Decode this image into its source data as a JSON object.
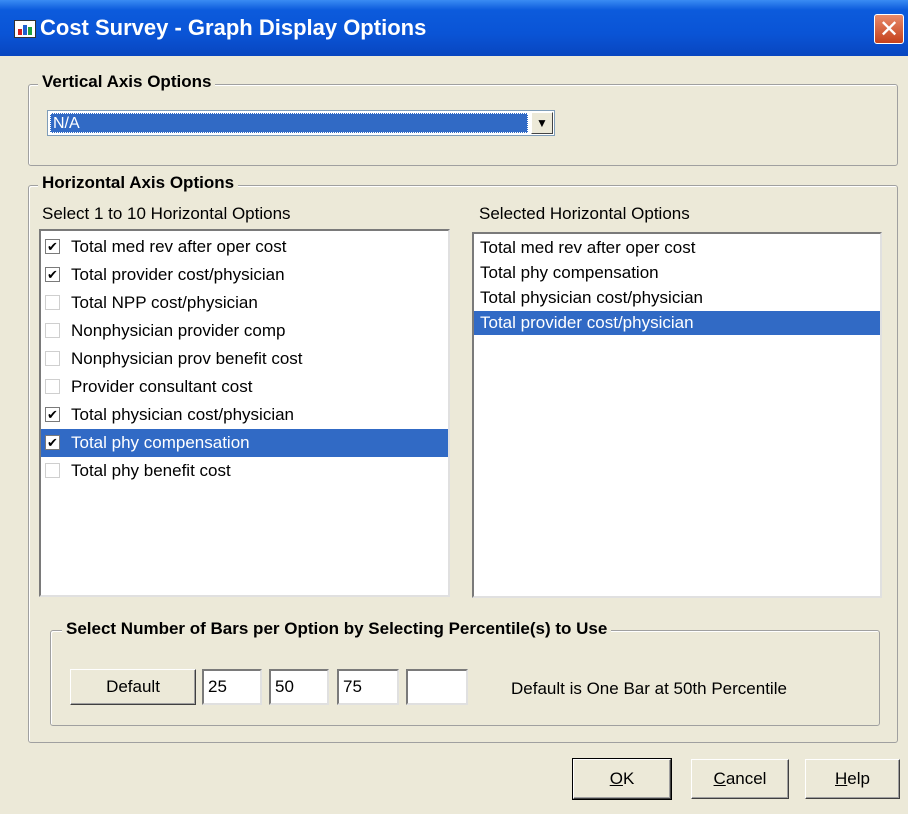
{
  "window": {
    "title": "Cost Survey - Graph Display Options",
    "close_glyph": "✕"
  },
  "vertical_axis": {
    "group_title": "Vertical  Axis Options",
    "selected_value": "N/A"
  },
  "horizontal_axis": {
    "group_title": "Horizontal Axis Options",
    "left_label": "Select 1 to 10 Horizontal Options",
    "right_label": "Selected Horizontal Options",
    "options": [
      {
        "label": "Total med rev after oper cost",
        "checked": true
      },
      {
        "label": "Total provider cost/physician",
        "checked": true
      },
      {
        "label": "Total NPP cost/physician",
        "checked": false
      },
      {
        "label": "Nonphysician provider comp",
        "checked": false
      },
      {
        "label": "Nonphysician prov benefit cost",
        "checked": false
      },
      {
        "label": "Provider consultant cost",
        "checked": false
      },
      {
        "label": "Total physician cost/physician",
        "checked": true
      },
      {
        "label": "Total phy compensation",
        "checked": true,
        "highlighted": true
      },
      {
        "label": "Total phy benefit cost",
        "checked": false
      }
    ],
    "selected": [
      "Total med rev after oper cost",
      "Total phy compensation",
      "Total physician cost/physician",
      "Total provider cost/physician"
    ],
    "selected_highlight_index": 3
  },
  "percentiles": {
    "group_title": "Select Number of Bars per Option by Selecting Percentile(s) to Use",
    "default_label": "Default",
    "values": [
      "25",
      "50",
      "75",
      ""
    ],
    "note": "Default is One Bar at 50th Percentile"
  },
  "buttons": {
    "ok": {
      "mnemonic": "O",
      "rest": "K"
    },
    "cancel": {
      "mnemonic": "C",
      "rest": "ancel"
    },
    "help": {
      "mnemonic": "H",
      "rest": "elp"
    }
  },
  "icons": {
    "checkmark": "✔",
    "dropdown": "▼"
  },
  "colors": {
    "selection": "#316ac5",
    "titlebar": "#0a54d6",
    "dialog_bg": "#ece9d8"
  }
}
